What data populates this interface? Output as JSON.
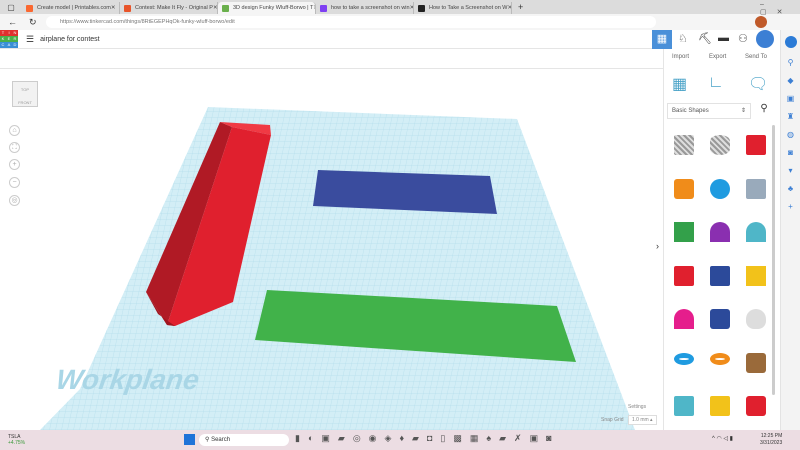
{
  "tabs": [
    {
      "label": "Create model | Printables.com",
      "color": "#fa6831"
    },
    {
      "label": "Contest: Make It Fly - Original P",
      "color": "#e8542a"
    },
    {
      "label": "3D design Funky Wluff-Borwo | T",
      "color": "#6ab04c"
    },
    {
      "label": "how to take a screenshot on win",
      "color": "#7e3ff2"
    },
    {
      "label": "How to Take a Screenshot on W",
      "color": "#222222"
    }
  ],
  "url": "https://www.tinkercad.com/things/8RtEGEPHqOk-funky-wluff-borwo/edit",
  "logo_letters": [
    "T",
    "I",
    "N",
    "K",
    "E",
    "R",
    "C",
    "A",
    "D"
  ],
  "design_title": "airplane for contest",
  "panel": {
    "import": "Import",
    "export": "Export",
    "send_to": "Send To",
    "category": "Basic Shapes"
  },
  "viewcube": {
    "top": "TOP",
    "front": "FRONT"
  },
  "workplane_label": "Workplane",
  "settings": "Settings",
  "snap_grid_label": "Snap Grid",
  "snap_grid_value": "1.0 mm",
  "taskbar": {
    "stock": "TSLA",
    "change": "+4.75%",
    "search": "Search",
    "time": "12:25 PM",
    "date": "3/31/2023"
  },
  "shapes": [
    "box-hole",
    "cylinder-hole",
    "box",
    "cylinder",
    "sphere",
    "scribble",
    "roof",
    "cone",
    "round-roof",
    "text",
    "half-sphere-box",
    "pyramid",
    "paraboloid",
    "hexagonal-prism",
    "cone-round",
    "torus",
    "tube",
    "wedge",
    "star",
    "heart-star",
    "polyhedron"
  ],
  "colors": {
    "accent": "#4a90d9",
    "red": "#e0202e",
    "blue": "#3a4c9e",
    "green": "#41b24a",
    "grid": "#bfe4ef"
  }
}
